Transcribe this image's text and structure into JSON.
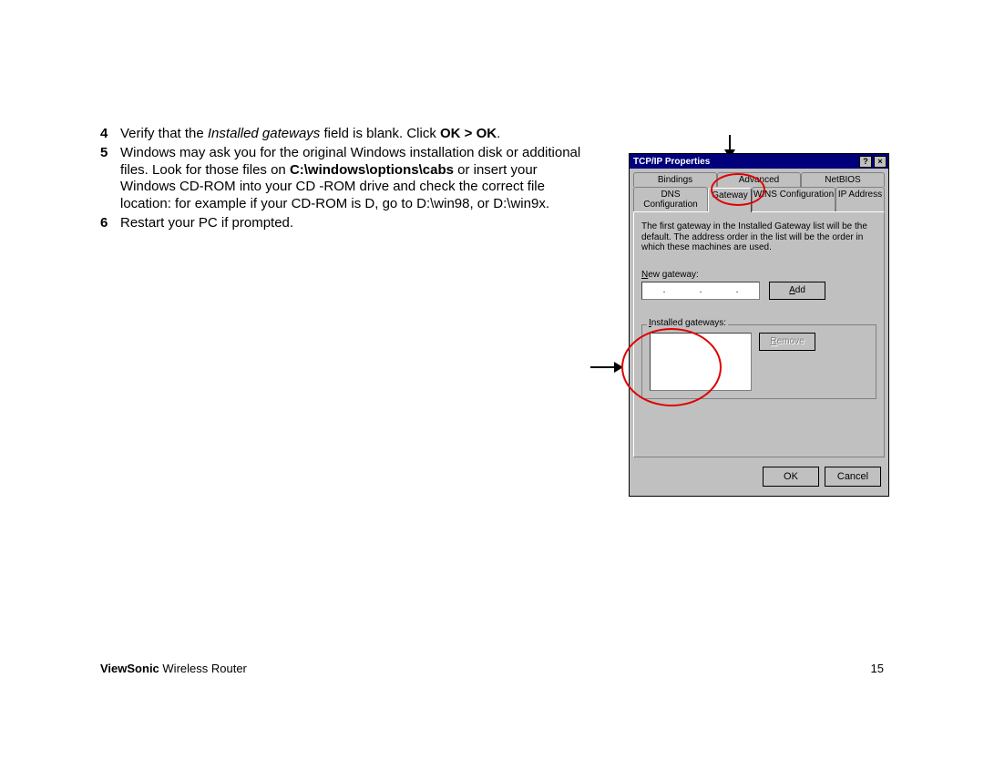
{
  "steps": [
    {
      "num": "4",
      "pre": "Verify that the ",
      "italic": "Installed gateways",
      "mid": " field is blank. Click ",
      "bold": "OK > OK",
      "post": "."
    },
    {
      "num": "5",
      "pre": "Windows may ask you for the original Windows installation disk or additional files. Look for those files on ",
      "bold": "C:\\windows\\options\\cabs",
      "post": " or insert your Windows CD-ROM into your CD -ROM drive and check the correct file location: for example if your CD-ROM is D, go to D:\\win98, or D:\\win9x."
    },
    {
      "num": "6",
      "pre": "Restart your PC if prompted."
    }
  ],
  "footer": {
    "brand": "ViewSonic",
    "product": " Wireless Router",
    "page": "15"
  },
  "dialog": {
    "title": "TCP/IP Properties",
    "helpGlyph": "?",
    "closeGlyph": "×",
    "tabsRow1": [
      "Bindings",
      "Advanced",
      "NetBIOS"
    ],
    "tabsRow2": [
      "DNS Configuration",
      "Gateway",
      "WINS Configuration",
      "IP Address"
    ],
    "activeTabIndex": 1,
    "hint": "The first gateway in the Installed Gateway list will be the default. The address order in the list will be the order in which these machines are used.",
    "newGatewayLabel": "New gateway:",
    "addLabel": "Add",
    "installedLabel": "Installed gateways:",
    "removeLabel": "Remove",
    "okLabel": "OK",
    "cancelLabel": "Cancel",
    "ipDots": [
      ".",
      ".",
      "."
    ]
  }
}
